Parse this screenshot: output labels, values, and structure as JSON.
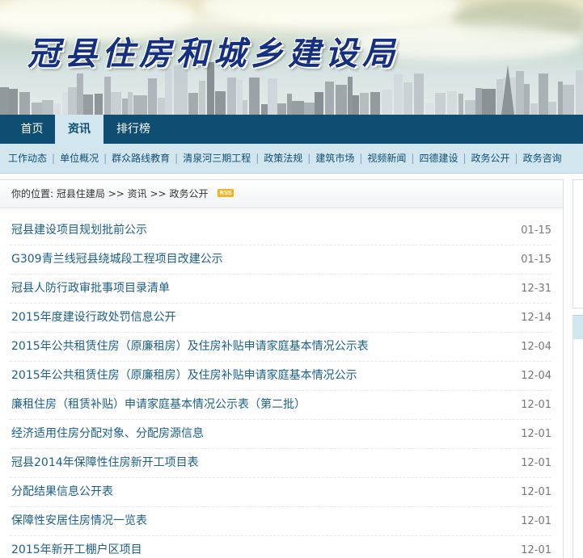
{
  "site": {
    "title": "冠县住房和城乡建设局"
  },
  "main_nav": [
    {
      "label": "首页",
      "active": false
    },
    {
      "label": "资讯",
      "active": true
    },
    {
      "label": "排行榜",
      "active": false
    }
  ],
  "sub_nav": [
    "工作动态",
    "单位概况",
    "群众路线教育",
    "清泉河三期工程",
    "政策法规",
    "建筑市场",
    "视频新闻",
    "四德建设",
    "政务公开",
    "政务咨询"
  ],
  "breadcrumb": {
    "prefix": "你的位置:",
    "items": [
      "冠县住建局",
      "资讯",
      "政务公开"
    ],
    "separator": ">>",
    "rss_label": "RSS"
  },
  "articles": [
    {
      "title": "冠县建设项目规划批前公示",
      "date": "01-15"
    },
    {
      "title": "G309青兰线冠县绕城段工程项目改建公示",
      "date": "01-15"
    },
    {
      "title": "冠县人防行政审批事项目录清单",
      "date": "12-31"
    },
    {
      "title": "2015年度建设行政处罚信息公开",
      "date": "12-14"
    },
    {
      "title": "2015年公共租赁住房（原廉租房）及住房补贴申请家庭基本情况公示表",
      "date": "12-04"
    },
    {
      "title": "2015年公共租赁住房（原廉租房）及住房补贴申请家庭基本情况公示",
      "date": "12-04"
    },
    {
      "title": "廉租住房（租赁补贴）申请家庭基本情况公示表（第二批）",
      "date": "12-01"
    },
    {
      "title": "经济适用住房分配对象、分配房源信息",
      "date": "12-01"
    },
    {
      "title": "冠县2014年保障性住房新开工项目表",
      "date": "12-01"
    },
    {
      "title": "分配结果信息公开表",
      "date": "12-01"
    },
    {
      "title": "保障性安居住房情况一览表",
      "date": "12-01"
    },
    {
      "title": "2015年新开工棚户区项目",
      "date": "12-01"
    }
  ],
  "colors": {
    "nav_bg": "#0f4e73",
    "subnav_bg": "#d2e6f0",
    "title_blue": "#15307f",
    "link_blue": "#1b5f86"
  }
}
